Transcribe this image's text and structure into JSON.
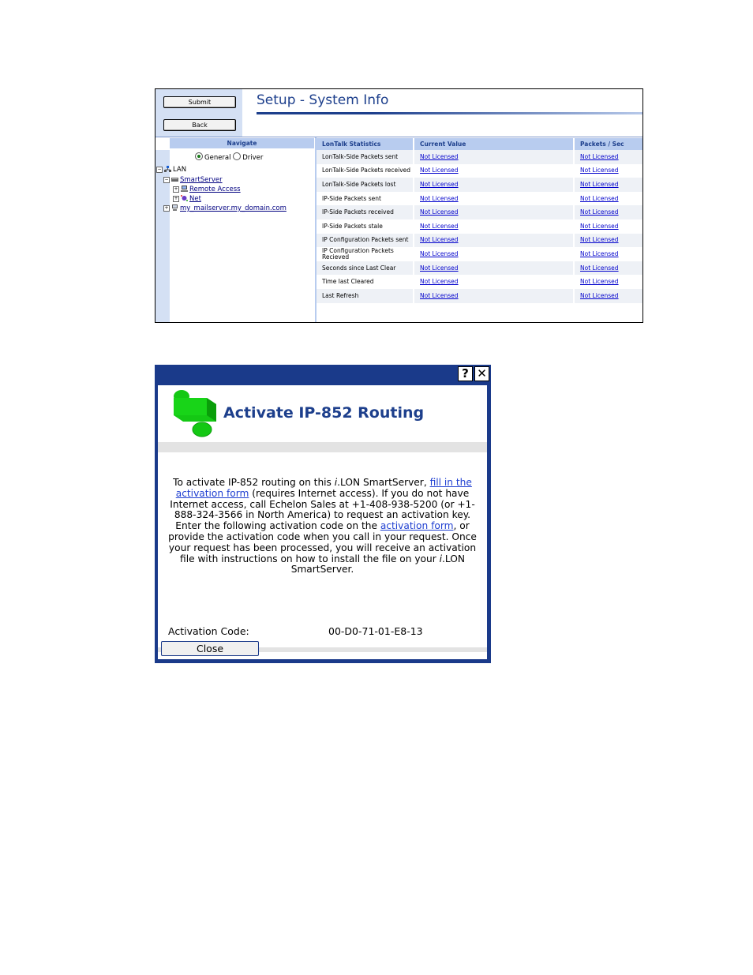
{
  "system_info": {
    "buttons": {
      "submit": "Submit",
      "back": "Back"
    },
    "title": "Setup - System Info",
    "navigate": {
      "header": "Navigate",
      "radio_general": "General",
      "radio_driver": "Driver",
      "tree": {
        "lan": "LAN",
        "smartserver": "SmartServer",
        "remote_access": "Remote Access",
        "net": "Net",
        "mailserver": "my_mailserver.my_domain.com"
      }
    },
    "table": {
      "headers": [
        "LonTalk Statistics",
        "Current Value",
        "Packets / Sec"
      ],
      "rows": [
        {
          "stat": "LonTalk-Side Packets sent",
          "value": "Not Licensed",
          "rate": "Not Licensed"
        },
        {
          "stat": "LonTalk-Side Packets received",
          "value": "Not Licensed",
          "rate": "Not Licensed"
        },
        {
          "stat": "LonTalk-Side Packets lost",
          "value": "Not Licensed",
          "rate": "Not Licensed"
        },
        {
          "stat": "IP-Side Packets sent",
          "value": "Not Licensed",
          "rate": "Not Licensed"
        },
        {
          "stat": "IP-Side Packets received",
          "value": "Not Licensed",
          "rate": "Not Licensed"
        },
        {
          "stat": "IP-Side Packets stale",
          "value": "Not Licensed",
          "rate": "Not Licensed"
        },
        {
          "stat": "IP Configuration Packets sent",
          "value": "Not Licensed",
          "rate": "Not Licensed"
        },
        {
          "stat": "IP Configuration Packets Recieved",
          "value": "Not Licensed",
          "rate": "Not Licensed"
        },
        {
          "stat": "Seconds since Last Clear",
          "value": "Not Licensed",
          "rate": "Not Licensed"
        },
        {
          "stat": "Time last Cleared",
          "value": "Not Licensed",
          "rate": "Not Licensed"
        },
        {
          "stat": "Last Refresh",
          "value": "Not Licensed",
          "rate": "Not Licensed"
        }
      ]
    }
  },
  "activate_dialog": {
    "help_button": "?",
    "close_x": "✕",
    "heading": "Activate IP-852 Routing",
    "text": {
      "p1": "To activate IP-852 routing on this ",
      "p1_italic": "i",
      "p1b": ".LON SmartServer, ",
      "link_fill": "fill in the activation form",
      "p2": " (requires Internet access). If you do not have Internet access, call Echelon Sales at +1-408-938-5200 (or +1-888-324-3566 in North America) to request an activation key. Enter the following activation code on the ",
      "link_form": "activation form",
      "p3": ", or provide the activation code when you call in your request. Once your request has been processed, you will receive an activation file with instructions on how to install the file on your ",
      "p3_italic": "i",
      "p3b": ".LON SmartServer."
    },
    "code_label": "Activation Code:",
    "code_value": "00-D0-71-01-E8-13",
    "close_button": "Close",
    "colors": {
      "frame": "#1a3a8a",
      "heading": "#1d3f8c",
      "logo": "#14c814",
      "link": "#1f3fd1"
    }
  }
}
